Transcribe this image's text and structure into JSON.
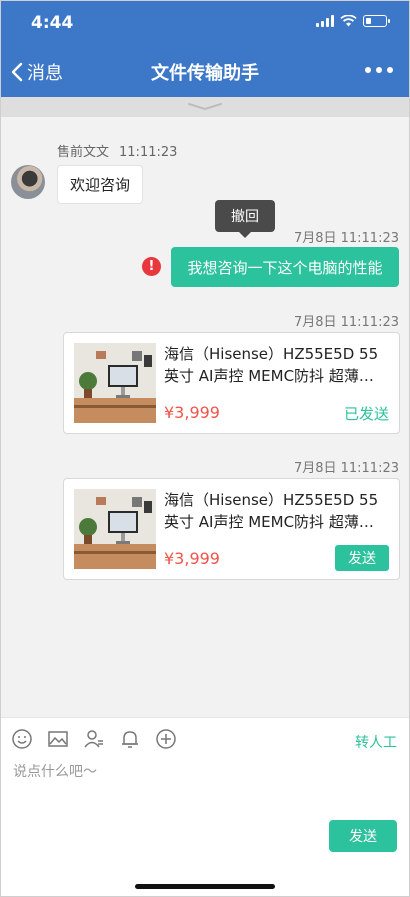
{
  "status_bar": {
    "time": "4:44",
    "battery_level": 0.3
  },
  "nav": {
    "back_label": "消息",
    "title": "文件传输助手"
  },
  "chat": {
    "incoming": {
      "sender": "售前文文",
      "time": "11:11:23",
      "text": "欢迎咨询"
    },
    "tooltip_label": "撤回",
    "outgoing": {
      "timestamp": "7月8日 11:11:23",
      "text": "我想咨询一下这个电脑的性能",
      "status_icon": "error-icon",
      "status_symbol": "!"
    },
    "cards": [
      {
        "timestamp": "7月8日 11:11:23",
        "title": "海信（Hisense）HZ55E5D 55英寸 AI声控 MEMC防抖 超薄…",
        "price": "¥3,999",
        "status": "已发送"
      },
      {
        "timestamp": "7月8日 11:11:23",
        "title": "海信（Hisense）HZ55E5D 55英寸 AI声控 MEMC防抖 超薄…",
        "price": "¥3,999",
        "action": "发送"
      }
    ]
  },
  "input_bar": {
    "tools": [
      "emoji-icon",
      "image-icon",
      "contact-card-icon",
      "service-bell-icon",
      "plus-icon"
    ],
    "transfer_label": "转人工",
    "placeholder": "说点什么吧～",
    "send_label": "发送"
  },
  "colors": {
    "header": "#3d78c8",
    "accent": "#2cc29d",
    "price": "#f0554a",
    "error": "#e8383d"
  }
}
